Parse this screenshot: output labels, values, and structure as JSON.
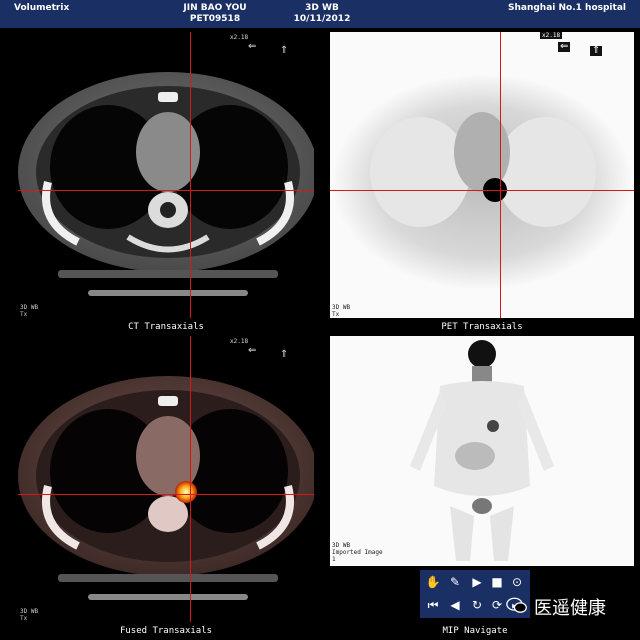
{
  "header": {
    "app": "Volumetrix",
    "patient_name": "JIN BAO YOU",
    "patient_id": "PET09518",
    "study_type": "3D WB",
    "study_date": "10/11/2012",
    "institution": "Shanghai No.1 hospital"
  },
  "viewports": {
    "ct": {
      "label": "CT Transaxials",
      "zoom": "x2.18",
      "corner_line1": "3D WB",
      "corner_line2": "Tx"
    },
    "pet": {
      "label": "PET Transaxials",
      "zoom": "x2.18",
      "corner_line1": "3D WB",
      "corner_line2": "Tx"
    },
    "fused": {
      "label": "Fused Transaxials",
      "zoom": "x2.18",
      "corner_line1": "3D WB",
      "corner_line2": "Tx"
    },
    "mip": {
      "label": "MIP Navigate",
      "corner_line1": "3D WB",
      "corner_line2": "Imported Image",
      "corner_line3": "1"
    }
  },
  "toolbar": {
    "buttons": [
      "hand-tool-icon",
      "pen-tool-icon",
      "play-icon",
      "stop-icon",
      "target-icon",
      "step-back-icon",
      "rewind-icon",
      "rotate-icon",
      "loop-icon",
      "step-forward-icon"
    ]
  },
  "watermark": {
    "text": "医遥健康"
  },
  "colors": {
    "header_bg": "#1a2f63",
    "crosshair": "#d81818"
  }
}
